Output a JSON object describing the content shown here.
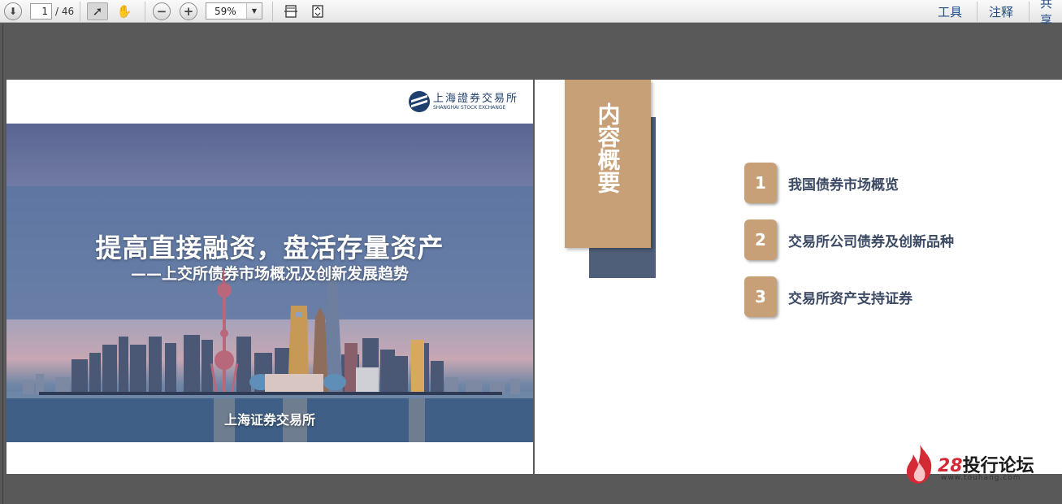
{
  "toolbar": {
    "page_current": "1",
    "page_total": "/ 46",
    "zoom": "59%",
    "tools_label": "工具",
    "comment_label": "注释",
    "share_label": "共享"
  },
  "slide1": {
    "logo_cn": "上海證券交易所",
    "logo_en": "SHANGHAI STOCK EXCHANGE",
    "title": "提高直接融资，盘活存量资产",
    "subtitle": "——上交所债券市场概况及创新发展趋势",
    "footer": "上海证券交易所"
  },
  "slide2": {
    "toc_title": "内容概要",
    "items": [
      {
        "num": "1",
        "label": "我国债券市场概览"
      },
      {
        "num": "2",
        "label": "交易所公司债券及创新品种"
      },
      {
        "num": "3",
        "label": "交易所资产支持证券"
      }
    ]
  },
  "watermark": {
    "num": "28",
    "text": "投行论坛",
    "url": "www.touhang.com"
  },
  "colors": {
    "accent_tan": "#c8a077",
    "accent_navy": "#4f5e79",
    "link_blue": "#1f4a82"
  }
}
